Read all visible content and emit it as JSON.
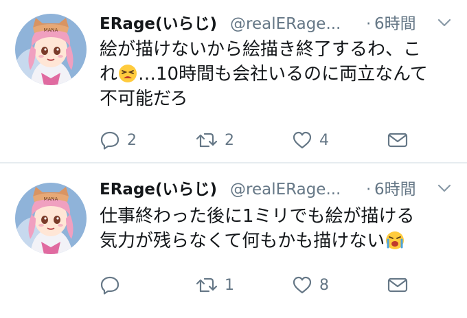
{
  "tweets": [
    {
      "name": "ERage(いらじ)",
      "handle": "@realERage...",
      "separator": "·",
      "time": "6時間",
      "lines": [
        "絵が描けないから絵描き終了するわ、こ",
        "…10時間も会社いるのに両立なんて",
        "不可能だろ"
      ],
      "line2_prefix": "れ",
      "emoji1": "tired-face-emoji",
      "reply_count": "2",
      "retweet_count": "2",
      "like_count": "4"
    },
    {
      "name": "ERage(いらじ)",
      "handle": "@realERage...",
      "separator": "·",
      "time": "6時間",
      "lines": [
        "仕事終わった後に1ミリでも絵が描ける",
        "気力が残らなくて何もかも描けない"
      ],
      "emoji2": "crying-face-emoji",
      "reply_count": "",
      "retweet_count": "1",
      "like_count": "8"
    }
  ],
  "colors": {
    "text": "#14171a",
    "secondary": "#657786",
    "divider": "#e6ecf0"
  },
  "icons": [
    "reply-icon",
    "retweet-icon",
    "like-icon",
    "message-icon",
    "chevron-down-icon"
  ]
}
